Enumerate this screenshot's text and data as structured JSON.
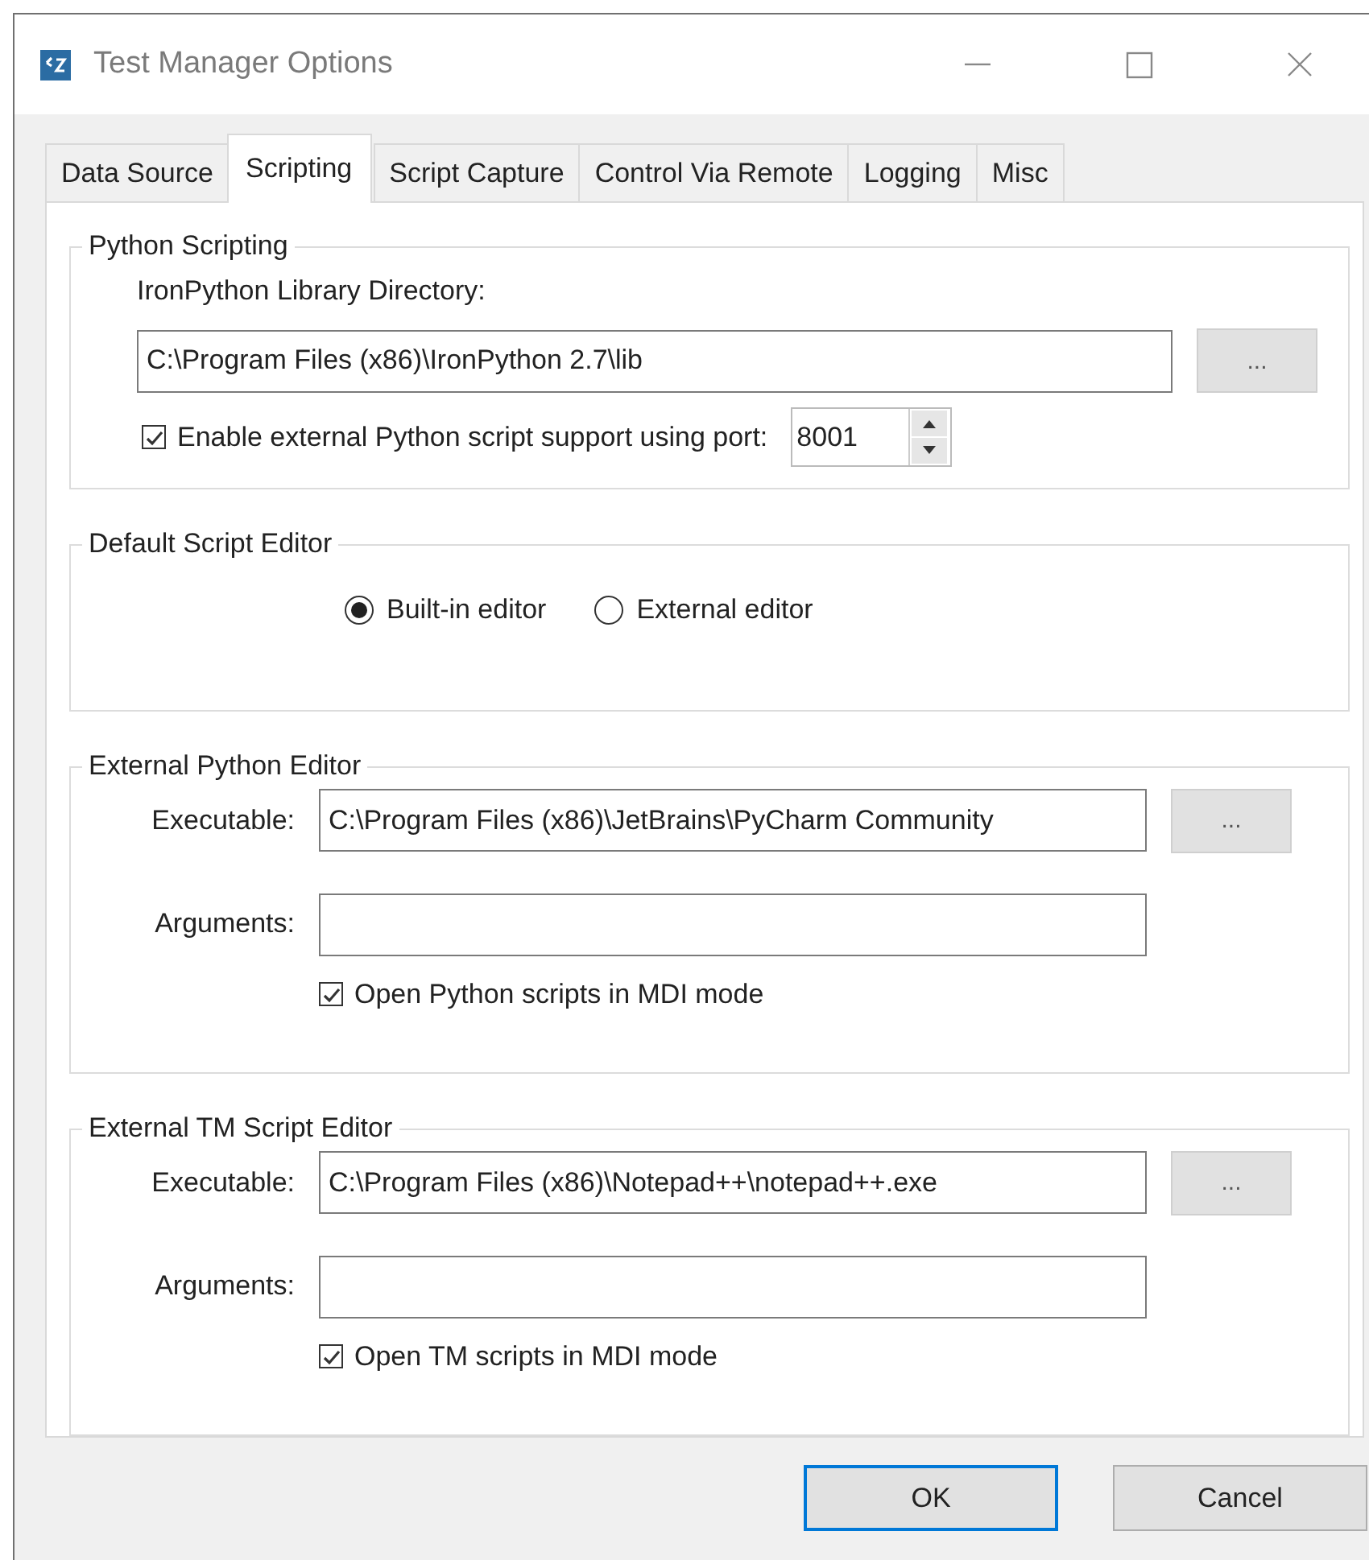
{
  "window": {
    "title": "Test Manager Options"
  },
  "tabs": [
    {
      "label": "Data Source",
      "selected": false
    },
    {
      "label": "Scripting",
      "selected": true
    },
    {
      "label": "Script Capture",
      "selected": false
    },
    {
      "label": "Control Via Remote",
      "selected": false
    },
    {
      "label": "Logging",
      "selected": false
    },
    {
      "label": "Misc",
      "selected": false
    }
  ],
  "python_scripting": {
    "title": "Python Scripting",
    "library_label": "IronPython Library Directory:",
    "library_value": "C:\\Program Files (x86)\\IronPython 2.7\\lib",
    "browse": "...",
    "external_support": {
      "label": "Enable external Python script support using port:",
      "checked": true
    },
    "port": "8001"
  },
  "default_editor": {
    "title": "Default Script Editor",
    "options": [
      {
        "label": "Built-in editor",
        "selected": true
      },
      {
        "label": "External editor",
        "selected": false
      }
    ]
  },
  "editors": [
    {
      "title": "External Python Editor",
      "executable_label": "Executable:",
      "executable_value": "C:\\Program Files (x86)\\JetBrains\\PyCharm Community",
      "browse": "...",
      "arguments_label": "Arguments:",
      "mdi": {
        "label": "Open Python scripts in MDI mode",
        "checked": true
      }
    },
    {
      "title": "External TM Script Editor",
      "executable_label": "Executable:",
      "executable_value": "C:\\Program Files (x86)\\Notepad++\\notepad++.exe",
      "browse": "...",
      "arguments_label": "Arguments:",
      "mdi": {
        "label": "Open TM scripts in MDI mode",
        "checked": true
      }
    }
  ],
  "buttons": [
    {
      "label": "OK",
      "default": true
    },
    {
      "label": "Cancel",
      "default": false
    }
  ]
}
